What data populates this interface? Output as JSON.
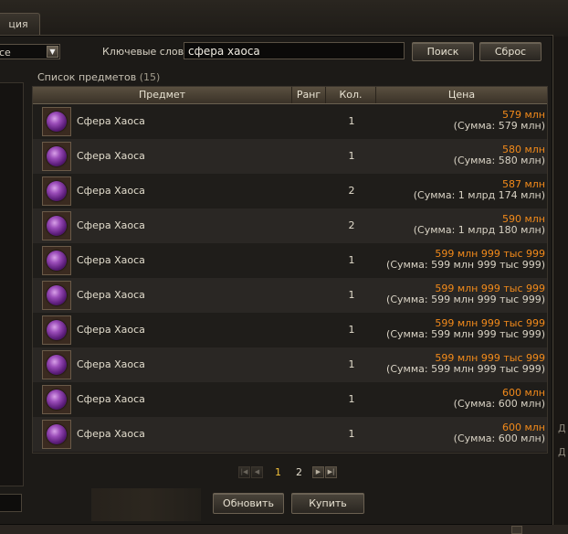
{
  "tab": {
    "label": "ция"
  },
  "filter": {
    "selected": "се"
  },
  "search": {
    "keywords_label": "Ключевые слова",
    "query": "сфера хаоса",
    "search_button": "Поиск",
    "reset_button": "Сброс"
  },
  "list": {
    "title": "Список предметов",
    "count": "(15)"
  },
  "columns": {
    "item": "Предмет",
    "rank": "Ранг",
    "qty": "Кол.",
    "price": "Цена"
  },
  "rows": [
    {
      "name": "Сфера Хаоса",
      "rank": "",
      "qty": "1",
      "price": "579 млн",
      "sum": "(Сумма: 579 млн)"
    },
    {
      "name": "Сфера Хаоса",
      "rank": "",
      "qty": "1",
      "price": "580 млн",
      "sum": "(Сумма: 580 млн)"
    },
    {
      "name": "Сфера Хаоса",
      "rank": "",
      "qty": "2",
      "price": "587 млн",
      "sum": "(Сумма: 1 млрд 174 млн)"
    },
    {
      "name": "Сфера Хаоса",
      "rank": "",
      "qty": "2",
      "price": "590 млн",
      "sum": "(Сумма: 1 млрд 180 млн)"
    },
    {
      "name": "Сфера Хаоса",
      "rank": "",
      "qty": "1",
      "price": "599 млн 999 тыс 999",
      "sum": "(Сумма: 599 млн 999 тыс 999)"
    },
    {
      "name": "Сфера Хаоса",
      "rank": "",
      "qty": "1",
      "price": "599 млн 999 тыс 999",
      "sum": "(Сумма: 599 млн 999 тыс 999)"
    },
    {
      "name": "Сфера Хаоса",
      "rank": "",
      "qty": "1",
      "price": "599 млн 999 тыс 999",
      "sum": "(Сумма: 599 млн 999 тыс 999)"
    },
    {
      "name": "Сфера Хаоса",
      "rank": "",
      "qty": "1",
      "price": "599 млн 999 тыс 999",
      "sum": "(Сумма: 599 млн 999 тыс 999)"
    },
    {
      "name": "Сфера Хаоса",
      "rank": "",
      "qty": "1",
      "price": "600 млн",
      "sum": "(Сумма: 600 млн)"
    },
    {
      "name": "Сфера Хаоса",
      "rank": "",
      "qty": "1",
      "price": "600 млн",
      "sum": "(Сумма: 600 млн)"
    }
  ],
  "pagination": {
    "first_icon": "first-page-icon",
    "prev_icon": "prev-page-icon",
    "next_icon": "next-page-icon",
    "last_icon": "last-page-icon",
    "pages": [
      "1",
      "2"
    ],
    "current": "1"
  },
  "actions": {
    "refresh": "Обновить",
    "buy": "Купить"
  },
  "side": {
    "right_text_1": "Д",
    "right_text_2": "Д"
  },
  "colors": {
    "price": "#f28a1a",
    "current_page": "#f2c13a",
    "header": "#4a4234"
  }
}
